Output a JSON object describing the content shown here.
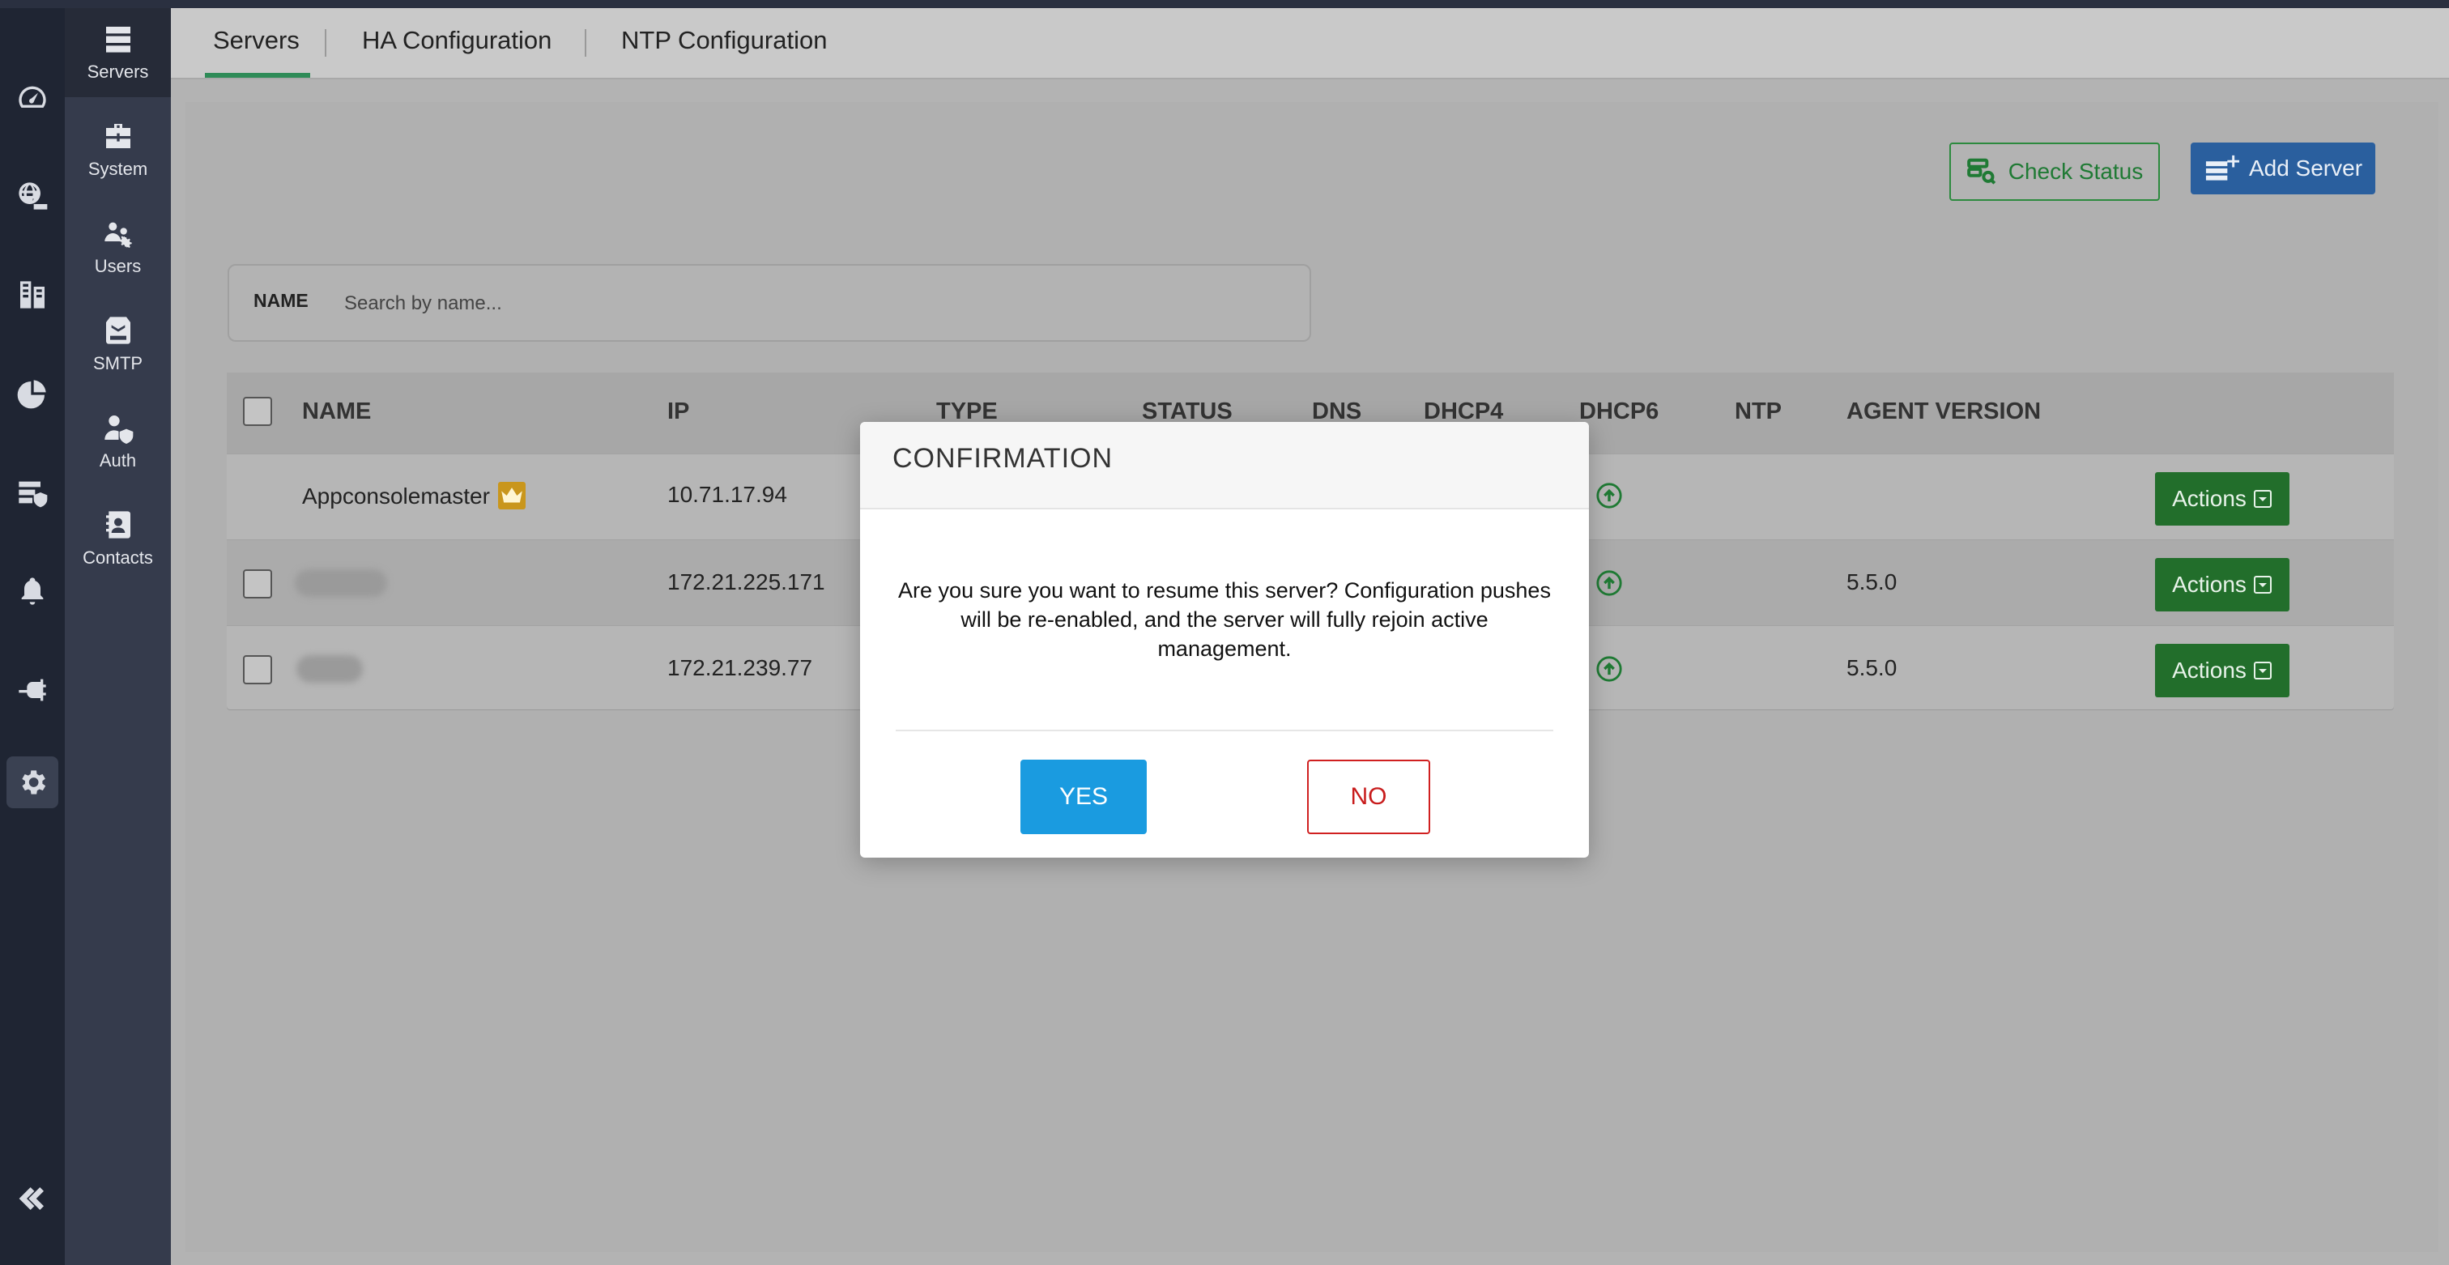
{
  "subnav": {
    "items": [
      {
        "label": "Servers",
        "icon": "server-icon"
      },
      {
        "label": "System",
        "icon": "toolbox-icon"
      },
      {
        "label": "Users",
        "icon": "users-gear-icon"
      },
      {
        "label": "SMTP",
        "icon": "mail-server-icon"
      },
      {
        "label": "Auth",
        "icon": "user-shield-icon"
      },
      {
        "label": "Contacts",
        "icon": "contact-book-icon"
      }
    ],
    "active": "Servers"
  },
  "rail": {
    "icons": [
      "dashboard-icon",
      "dns-globe-icon",
      "ipam-building-icon",
      "reports-pie-icon",
      "security-server-icon",
      "bell-icon",
      "plugin-icon",
      "settings-gear-icon"
    ],
    "active": "settings-gear-icon"
  },
  "tabs": [
    {
      "label": "Servers",
      "active": true
    },
    {
      "label": "HA Configuration",
      "active": false
    },
    {
      "label": "NTP Configuration",
      "active": false
    }
  ],
  "toolbar": {
    "check_status_label": "Check Status",
    "add_server_label": "Add Server"
  },
  "search": {
    "label": "NAME",
    "placeholder": "Search by name..."
  },
  "table": {
    "columns": [
      "NAME",
      "IP",
      "TYPE",
      "STATUS",
      "DNS",
      "DHCP4",
      "DHCP6",
      "NTP",
      "AGENT VERSION"
    ],
    "rows": [
      {
        "name": "Appconsolemaster",
        "ip": "10.71.17.94",
        "agent_version": "",
        "action": "Actions",
        "master": true
      },
      {
        "name": "",
        "ip": "172.21.225.171",
        "agent_version": "5.5.0",
        "action": "Actions",
        "master": false
      },
      {
        "name": "",
        "ip": "172.21.239.77",
        "agent_version": "5.5.0",
        "action": "Actions",
        "master": false
      }
    ]
  },
  "modal": {
    "title": "CONFIRMATION",
    "message": "Are you sure you want to resume this server? Configuration pushes will be re-enabled, and the server will fully rejoin active management.",
    "yes_label": "YES",
    "no_label": "NO"
  },
  "colors": {
    "accent_green": "#2e8b57",
    "actions_green": "#226e2b",
    "primary_blue": "#2a5f9e",
    "yes_blue": "#1a9be0",
    "no_red": "#c81c1c"
  }
}
